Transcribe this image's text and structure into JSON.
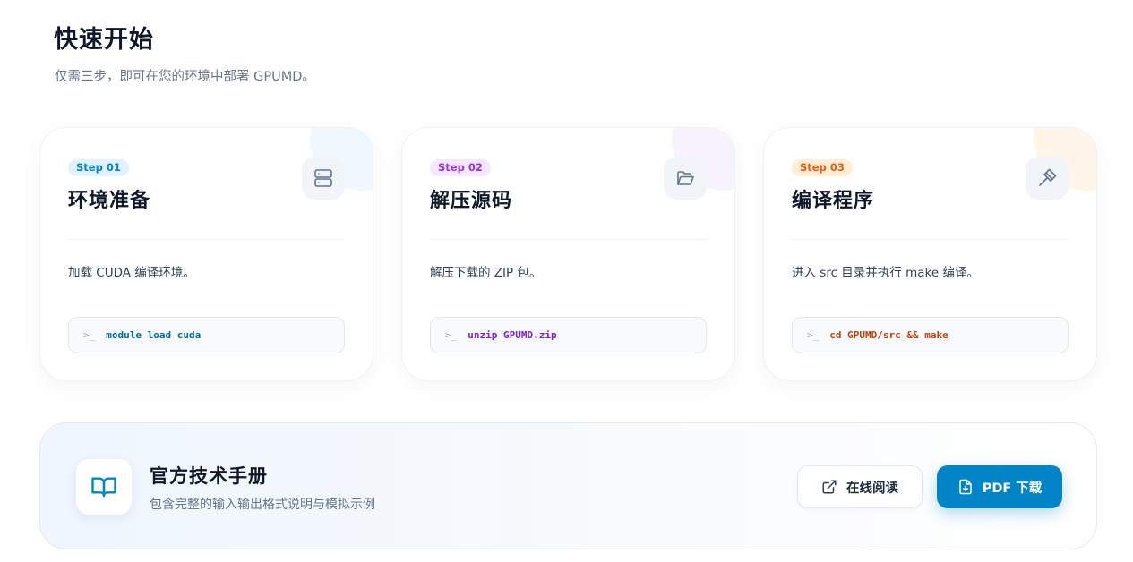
{
  "header": {
    "title": "快速开始",
    "subtitle": "仅需三步，即可在您的环境中部署 GPUMD。"
  },
  "steps": [
    {
      "badge": "Step 01",
      "title": "环境准备",
      "description": "加载 CUDA 编译环境。",
      "prompt": ">_",
      "command": "module load cuda",
      "icon": "server-icon",
      "accent": "#0284c7"
    },
    {
      "badge": "Step 02",
      "title": "解压源码",
      "description": "解压下载的 ZIP 包。",
      "prompt": ">_",
      "command": "unzip GPUMD.zip",
      "icon": "folder-open-icon",
      "accent": "#9333ea"
    },
    {
      "badge": "Step 03",
      "title": "编译程序",
      "description": "进入 src 目录并执行 make 编译。",
      "prompt": ">_",
      "command": "cd GPUMD/src && make",
      "icon": "hammer-icon",
      "accent": "#ea580c"
    }
  ],
  "manual": {
    "title": "官方技术手册",
    "subtitle": "包含完整的输入输出格式说明与模拟示例",
    "icon": "book-open-icon",
    "read_online_label": "在线阅读",
    "download_label": "PDF 下载",
    "accent": "#0284c7"
  }
}
